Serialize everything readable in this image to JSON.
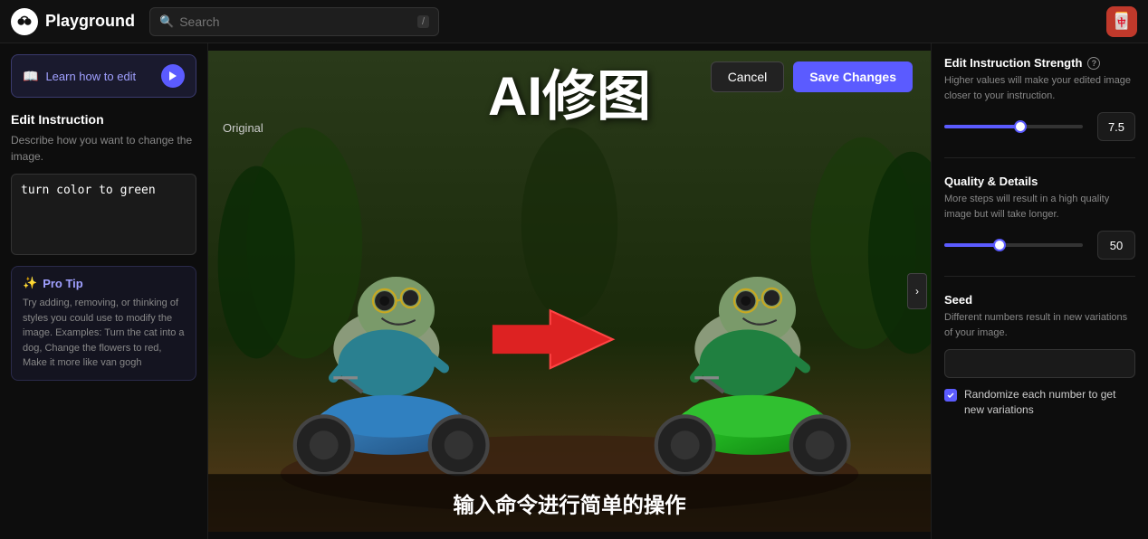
{
  "nav": {
    "logo_text": "Playground",
    "search_placeholder": "Search",
    "kbd_shortcut": "/",
    "user_emoji": "🀄"
  },
  "left_sidebar": {
    "learn_btn_label": "Learn how to edit",
    "edit_instruction_title": "Edit Instruction",
    "edit_instruction_desc": "Describe how you want to change the image.",
    "instruction_value": "turn color to green",
    "pro_tip_title": "Pro Tip",
    "pro_tip_text": "Try adding, removing, or thinking of styles you could use to modify the image. Examples: Turn the cat into a dog, Change the flowers to red, Make it more like van gogh"
  },
  "center": {
    "title": "AI修图",
    "original_label": "Original",
    "caption": "输入命令进行简单的操作",
    "cancel_label": "Cancel",
    "save_label": "Save Changes"
  },
  "right_sidebar": {
    "strength_title": "Edit Instruction Strength",
    "strength_desc": "Higher values will make your edited image closer to your instruction.",
    "strength_value": "7.5",
    "strength_percent": 55,
    "quality_title": "Quality & Details",
    "quality_desc": "More steps will result in a high quality image but will take longer.",
    "quality_value": "50",
    "quality_percent": 40,
    "seed_title": "Seed",
    "seed_desc": "Different numbers result in new variations of your image.",
    "seed_value": "",
    "randomize_label": "Randomize each number to get new variations"
  }
}
